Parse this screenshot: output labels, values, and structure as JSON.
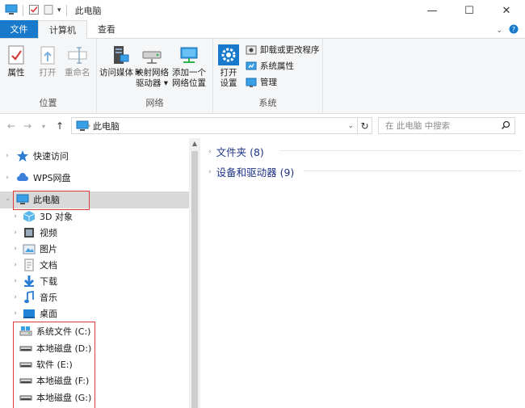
{
  "window": {
    "title": "此电脑",
    "minimize": "—",
    "maximize": "☐",
    "close": "✕"
  },
  "ribbon_tabs": [
    "文件",
    "计算机",
    "查看"
  ],
  "ribbon": {
    "location_group": {
      "label": "位置",
      "properties": "属性",
      "open": "打开",
      "rename": "重命名"
    },
    "network_group": {
      "label": "网络",
      "access_media_l1": "访问媒体",
      "map_drive_l1": "映射网络",
      "map_drive_l2": "驱动器",
      "add_location_l1": "添加一个",
      "add_location_l2": "网络位置"
    },
    "system_group": {
      "label": "系统",
      "open_settings_l1": "打开",
      "open_settings_l2": "设置",
      "uninstall": "卸载或更改程序",
      "system_properties": "系统属性",
      "manage": "管理"
    }
  },
  "address": {
    "path": "此电脑",
    "search_placeholder": "在 此电脑 中搜索"
  },
  "nav_items": [
    {
      "label": "快速访问"
    },
    {
      "label": "WPS网盘"
    },
    {
      "label": "此电脑"
    },
    {
      "label": "3D 对象"
    },
    {
      "label": "视频"
    },
    {
      "label": "图片"
    },
    {
      "label": "文档"
    },
    {
      "label": "下载"
    },
    {
      "label": "音乐"
    },
    {
      "label": "桌面"
    },
    {
      "label": "系统文件 (C:)"
    },
    {
      "label": "本地磁盘 (D:)"
    },
    {
      "label": "软件 (E:)"
    },
    {
      "label": "本地磁盘 (F:)"
    },
    {
      "label": "本地磁盘 (G:)"
    }
  ],
  "content": {
    "folders_header": "文件夹 (8)",
    "devices_header": "设备和驱动器 (9)"
  },
  "colors": {
    "accent": "#1979ca",
    "highlight_box": "#e03b3b",
    "section_header": "#1e3287"
  }
}
